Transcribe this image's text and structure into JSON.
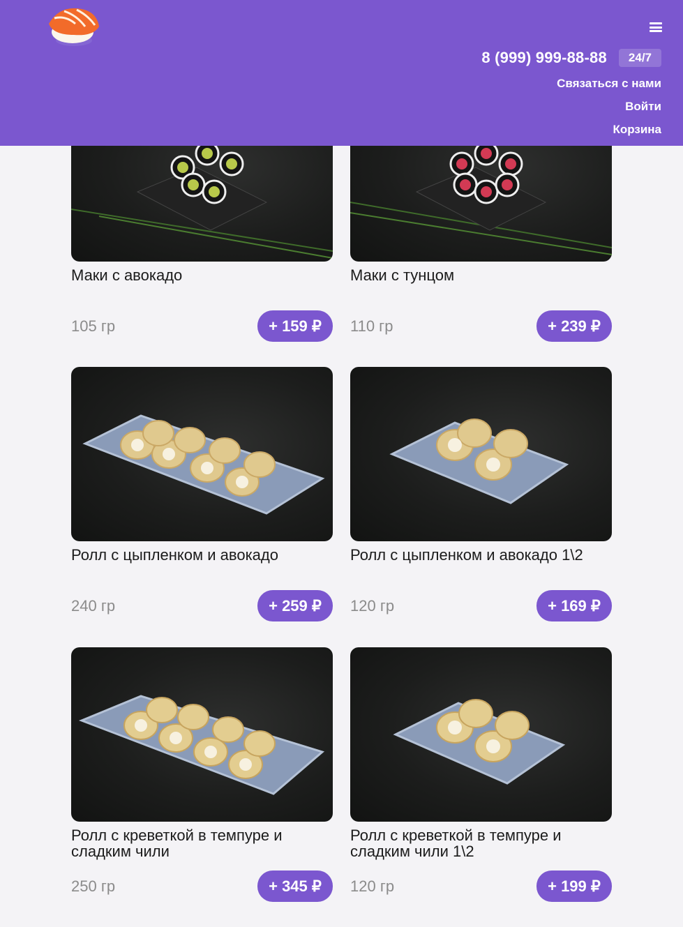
{
  "header": {
    "phone": "8 (999) 999-88-88",
    "badge": "24/7",
    "links": [
      "Связаться с нами",
      "Войти",
      "Корзина"
    ],
    "logo": "sushi-logo",
    "menu_icon": "hamburger-icon",
    "bg_color": "#7b57cf"
  },
  "products": [
    {
      "name": "Маки с авокадо",
      "weight": "105 гр",
      "price": "+ 159 ₽"
    },
    {
      "name": "Маки с тунцом",
      "weight": "110 гр",
      "price": "+ 239 ₽"
    },
    {
      "name": "Ролл с цыпленком и авокадо",
      "weight": "240 гр",
      "price": "+ 259 ₽"
    },
    {
      "name": "Ролл с цыпленком и авокадо 1\\2",
      "weight": "120 гр",
      "price": "+ 169 ₽"
    },
    {
      "name": "Ролл с креветкой в темпуре и сладким чили",
      "weight": "250 гр",
      "price": "+ 345 ₽"
    },
    {
      "name": "Ролл с креветкой в темпуре и сладким чили 1\\2",
      "weight": "120 гр",
      "price": "+ 199 ₽"
    }
  ]
}
